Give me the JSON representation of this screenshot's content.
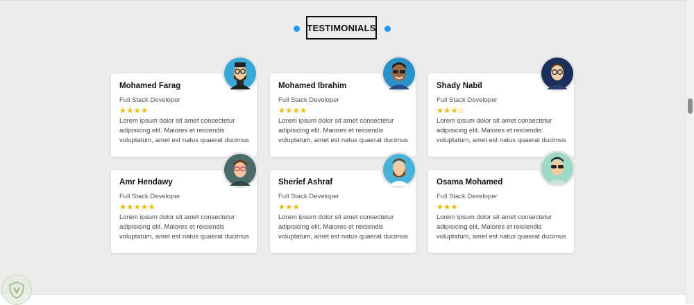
{
  "section": {
    "title": "TESTIMONIALS",
    "accent_color": "#2196f3",
    "star_color": "#f5b400"
  },
  "testimonials": [
    {
      "name": "Mohamed Farag",
      "role": "Full Stack Developer",
      "rating": 4,
      "stars": "★★★★",
      "text": "Lorem ipsum dolor sit amet consectetur adipisicing elit. Maiores et reiciendis voluptatum, amet est natus quaerat ducimus",
      "avatar": "avatar-bearded-man-glasses"
    },
    {
      "name": "Mohamed Ibrahim",
      "role": "Full Stack Developer",
      "rating": 4,
      "stars": "★★★★",
      "text": "Lorem ipsum dolor sit amet consectetur adipisicing elit. Maiores et reiciendis voluptatum, amet est natus quaerat ducimus",
      "avatar": "avatar-man-sunglasses"
    },
    {
      "name": "Shady Nabil",
      "role": "Full Stack Developer",
      "rating": 3,
      "stars": "★★★☆",
      "text": "Lorem ipsum dolor sit amet consectetur adipisicing elit. Maiores et reiciendis voluptatum, amet est natus quaerat ducimus",
      "avatar": "avatar-man-glasses-suit"
    },
    {
      "name": "Amr Hendawy",
      "role": "Full Stack Developer",
      "rating": 5,
      "stars": "★★★★★",
      "text": "Lorem ipsum dolor sit amet consectetur adipisicing elit. Maiores et reiciendis voluptatum, amet est natus quaerat ducimus",
      "avatar": "avatar-man-red-glasses"
    },
    {
      "name": "Sherief Ashraf",
      "role": "Full Stack Developer",
      "rating": 3,
      "stars": "★★★",
      "text": "Lorem ipsum dolor sit amet consectetur adipisicing elit. Maiores et reiciendis voluptatum, amet est natus quaerat ducimus",
      "avatar": "avatar-bearded-man"
    },
    {
      "name": "Osama Mohamed",
      "role": "Full Stack Developer",
      "rating": 3,
      "stars": "★★★",
      "text": "Lorem ipsum dolor sit amet consectetur adipisicing elit. Maiores et reiciendis voluptatum, amet est natus quaerat ducimus",
      "avatar": "avatar-man-dark-glasses"
    }
  ]
}
